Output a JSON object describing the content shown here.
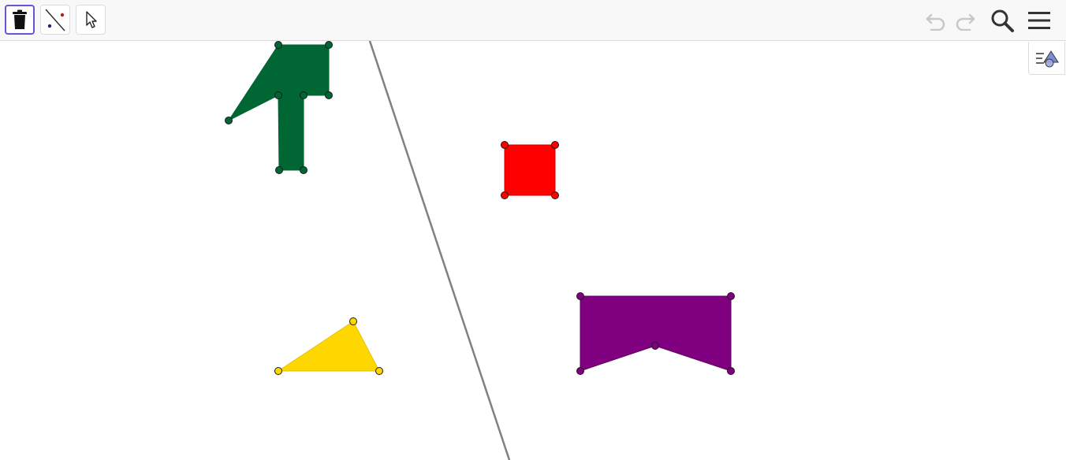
{
  "app": {
    "colors": {
      "toolbar_bg": "#f8f8f8",
      "selected_border": "#6557d2",
      "icon": "#333333",
      "icon_disabled": "#c8c8c8"
    }
  },
  "toolbar": {
    "tools": [
      {
        "name": "delete-tool",
        "icon": "trash-icon",
        "selected": true
      },
      {
        "name": "reflect-about-line-tool",
        "icon": "reflect-line-icon",
        "selected": false
      },
      {
        "name": "move-tool",
        "icon": "cursor-arrow-icon",
        "selected": false
      }
    ],
    "right": [
      {
        "name": "undo",
        "icon": "undo-icon",
        "enabled": false
      },
      {
        "name": "redo",
        "icon": "redo-icon",
        "enabled": false
      },
      {
        "name": "search",
        "icon": "search-icon",
        "enabled": true
      },
      {
        "name": "menu",
        "icon": "hamburger-menu-icon",
        "enabled": true
      }
    ],
    "algebra_toggle_icon": "algebra-view-icon"
  },
  "shapes": [
    {
      "name": "green-arrow-polygon",
      "fill": "#006633"
    },
    {
      "name": "red-square",
      "fill": "#ff0000"
    },
    {
      "name": "purple-pentagon",
      "fill": "#800080"
    },
    {
      "name": "yellow-triangle",
      "fill": "#ffd700"
    }
  ],
  "mirror_line": {
    "color": "#808080"
  }
}
